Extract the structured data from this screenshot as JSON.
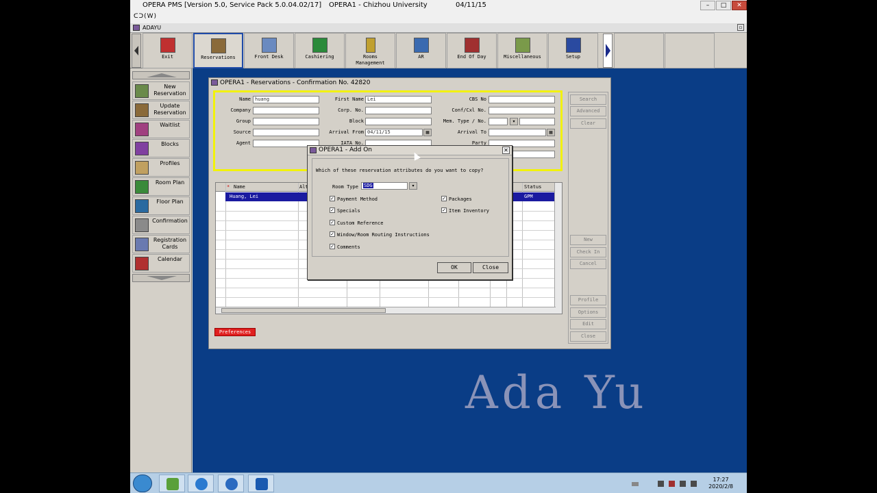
{
  "window": {
    "title": "OPERA PMS [Version 5.0, Service Pack 5.0.04.02/17]",
    "property": "OPERA1 - Chizhou University",
    "date": "04/11/15",
    "menu": "ᑕᑐ(W)",
    "user": "ADAYU"
  },
  "toolbar": {
    "items": [
      {
        "label": "Exit",
        "icon": "exit-icon",
        "color": "#c03030"
      },
      {
        "label": "Reservations",
        "icon": "reservations-icon",
        "color": "#8a6a3a"
      },
      {
        "label": "Front Desk",
        "icon": "front-desk-icon",
        "color": "#6a8ac0"
      },
      {
        "label": "Cashiering",
        "icon": "cashiering-icon",
        "color": "#2a8a3a"
      },
      {
        "label": "Rooms Management",
        "icon": "rooms-management-icon",
        "color": "#c0a030"
      },
      {
        "label": "AR",
        "icon": "ar-icon",
        "color": "#3a6ab0"
      },
      {
        "label": "End Of Day",
        "icon": "end-of-day-icon",
        "color": "#a03030"
      },
      {
        "label": "Miscellaneous",
        "icon": "miscellaneous-icon",
        "color": "#7a9a4a"
      },
      {
        "label": "Setup",
        "icon": "setup-icon",
        "color": "#2a4aa0"
      }
    ],
    "active_index": 1
  },
  "sidenav": {
    "items": [
      {
        "label": "New Reservation",
        "icon": "new-reservation-icon",
        "color": "#6a8a4a"
      },
      {
        "label": "Update Reservation",
        "icon": "update-reservation-icon",
        "color": "#8a6a3a"
      },
      {
        "label": "Waitlist",
        "icon": "waitlist-icon",
        "color": "#a04080"
      },
      {
        "label": "Blocks",
        "icon": "blocks-icon",
        "color": "#8040a0"
      },
      {
        "label": "Profiles",
        "icon": "profiles-icon",
        "color": "#c0a060"
      },
      {
        "label": "Room Plan",
        "icon": "room-plan-icon",
        "color": "#3a8a3a"
      },
      {
        "label": "Floor Plan",
        "icon": "floor-plan-icon",
        "color": "#2a6aa0"
      },
      {
        "label": "Confirmation",
        "icon": "confirmation-icon",
        "color": "#8a8a8a"
      },
      {
        "label": "Registration Cards",
        "icon": "registration-cards-icon",
        "color": "#6a7ab0"
      },
      {
        "label": "Calendar",
        "icon": "calendar-icon",
        "color": "#b03030"
      }
    ]
  },
  "reservations_window": {
    "title": "OPERA1 - Reservations - Confirmation No. 42820",
    "fields": {
      "name_label": "Name",
      "name_value": "huang",
      "first_name_label": "First Name",
      "first_name_value": "Lei",
      "cbs_label": "CBS No",
      "cbs_value": "",
      "company_label": "Company",
      "company_value": "",
      "corp_label": "Corp. No.",
      "corp_value": "",
      "conf_label": "Conf/Cxl No.",
      "conf_value": "",
      "group_label": "Group",
      "group_value": "",
      "block_label": "Block",
      "block_value": "",
      "mem_label": "Mem. Type / No.",
      "mem_value": "",
      "source_label": "Source",
      "source_value": "",
      "arrival_from_label": "Arrival From",
      "arrival_from_value": "04/11/15",
      "arrival_to_label": "Arrival To",
      "arrival_to_value": "",
      "agent_label": "Agent",
      "agent_value": "",
      "iata_label": "IATA No.",
      "iata_value": "",
      "party_label": "Party",
      "party_value": ""
    },
    "side_buttons": {
      "search": "Search",
      "advanced": "Advanced",
      "clear": "Clear",
      "new": "New",
      "check_in": "Check In",
      "cancel": "Cancel",
      "profile": "Profile",
      "options": "Options",
      "edit": "Edit",
      "close": "Close"
    },
    "grid": {
      "col_star": "*",
      "col_name": "Name",
      "col_alt": "Alt",
      "col_status": "Status",
      "row1_name": "Huang, Lei",
      "row1_status": "GPM"
    },
    "preferences": "Preferences"
  },
  "addon_dialog": {
    "title": "OPERA1 - Add On",
    "question": "Which of these reservation attributes do you want to copy?",
    "room_type_label": "Room Type",
    "room_type_value": "SDG",
    "options": {
      "payment_method": "Payment Method",
      "specials": "Specials",
      "custom_reference": "Custom Reference",
      "window_routing": "Window/Room Routing Instructions",
      "comments": "Comments",
      "packages": "Packages",
      "item_inventory": "Item Inventory"
    },
    "ok": "OK",
    "close": "Close"
  },
  "watermark": "Ada Yu",
  "taskbar": {
    "time": "17:27",
    "date": "2020/2/8"
  }
}
